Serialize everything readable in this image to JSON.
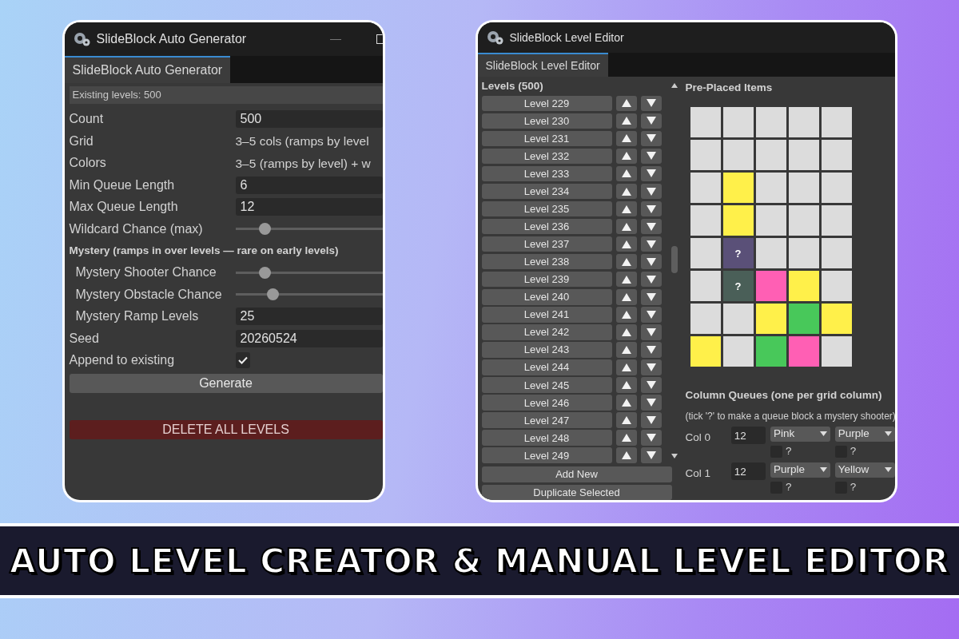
{
  "generator_window": {
    "title": "SlideBlock Auto Generator",
    "tab": {
      "label": "SlideBlock Auto Generator",
      "selected": true
    },
    "info": "Existing levels: 500",
    "rows": [
      {
        "kind": "field",
        "label": "Count",
        "value": "500"
      },
      {
        "kind": "text",
        "label": "Grid",
        "value": "3–5 cols (ramps by level"
      },
      {
        "kind": "text",
        "label": "Colors",
        "value": "3–5 (ramps by level) + w"
      },
      {
        "kind": "field",
        "label": "Min Queue Length",
        "value": "6"
      },
      {
        "kind": "field",
        "label": "Max Queue Length",
        "value": "12"
      },
      {
        "kind": "slider",
        "label": "Wildcard Chance (max)",
        "level": 0.2
      },
      {
        "kind": "section",
        "label": "Mystery (ramps in over levels — rare on early levels)",
        "children": [
          {
            "kind": "slider",
            "label": "Mystery Shooter Chance",
            "level": 0.2
          },
          {
            "kind": "slider",
            "label": "Mystery Obstacle Chance",
            "level": 0.25
          },
          {
            "kind": "field",
            "label": "Mystery Ramp Levels",
            "value": "25"
          }
        ]
      },
      {
        "kind": "field",
        "label": "Seed",
        "value": "20260524"
      },
      {
        "kind": "checkbox",
        "label": "Append to existing",
        "checked": true
      }
    ],
    "buttons": [
      {
        "kind": "normal",
        "label": "Generate"
      },
      {
        "kind": "danger",
        "label": "DELETE ALL LEVELS"
      }
    ]
  },
  "editor_window": {
    "title": "SlideBlock Level Editor",
    "tab": {
      "label": "SlideBlock Level Editor",
      "selected": true
    },
    "list_title": "Levels (500)",
    "levels": [
      "Level 229",
      "Level 230",
      "Level 231",
      "Level 232",
      "Level 233",
      "Level 234",
      "Level 235",
      "Level 236",
      "Level 237",
      "Level 238",
      "Level 239",
      "Level 240",
      "Level 241",
      "Level 242",
      "Level 243",
      "Level 244",
      "Level 245",
      "Level 246",
      "Level 247",
      "Level 248",
      "Level 249"
    ],
    "list_buttons": [
      "Add New",
      "Duplicate Selected"
    ],
    "grid_title": "Pre-Placed Items",
    "grid": [
      [
        {
          "color": "#dcdcdc"
        },
        {
          "color": "#dcdcdc"
        },
        {
          "color": "#dcdcdc"
        },
        {
          "color": "#dcdcdc"
        },
        {
          "color": "#dcdcdc"
        }
      ],
      [
        {
          "color": "#dcdcdc"
        },
        {
          "color": "#dcdcdc"
        },
        {
          "color": "#dcdcdc"
        },
        {
          "color": "#dcdcdc"
        },
        {
          "color": "#dcdcdc"
        }
      ],
      [
        {
          "color": "#dcdcdc"
        },
        {
          "color": "#fff04a"
        },
        {
          "color": "#dcdcdc"
        },
        {
          "color": "#dcdcdc"
        },
        {
          "color": "#dcdcdc"
        }
      ],
      [
        {
          "color": "#dcdcdc"
        },
        {
          "color": "#fff04a"
        },
        {
          "color": "#dcdcdc"
        },
        {
          "color": "#dcdcdc"
        },
        {
          "color": "#dcdcdc"
        }
      ],
      [
        {
          "color": "#dcdcdc"
        },
        {
          "color": "#5a5078",
          "text": "?"
        },
        {
          "color": "#dcdcdc"
        },
        {
          "color": "#dcdcdc"
        },
        {
          "color": "#dcdcdc"
        }
      ],
      [
        {
          "color": "#dcdcdc"
        },
        {
          "color": "#4a5f58",
          "text": "?"
        },
        {
          "color": "#ff5fb4"
        },
        {
          "color": "#fff04a"
        },
        {
          "color": "#dcdcdc"
        }
      ],
      [
        {
          "color": "#dcdcdc"
        },
        {
          "color": "#dcdcdc"
        },
        {
          "color": "#fff04a"
        },
        {
          "color": "#48c85a"
        },
        {
          "color": "#fff04a"
        }
      ],
      [
        {
          "color": "#fff04a"
        },
        {
          "color": "#dcdcdc"
        },
        {
          "color": "#48c85a"
        },
        {
          "color": "#ff5fb4"
        },
        {
          "color": "#dcdcdc"
        }
      ]
    ],
    "queues_title": "Column Queues (one per grid column)",
    "queues_hint": "(tick '?' to make a queue block a mystery shooter)",
    "queues": [
      {
        "label": "Col 0",
        "count": "12",
        "slots": [
          {
            "value": "Pink",
            "mark": "?",
            "checked": false
          },
          {
            "value": "Purple",
            "mark": "?",
            "checked": false
          }
        ]
      },
      {
        "label": "Col 1",
        "count": "12",
        "slots": [
          {
            "value": "Purple",
            "mark": "?",
            "checked": false
          },
          {
            "value": "Yellow",
            "mark": "?",
            "checked": false
          }
        ]
      }
    ]
  },
  "banner": "AUTO LEVEL CREATOR & MANUAL LEVEL EDITOR"
}
